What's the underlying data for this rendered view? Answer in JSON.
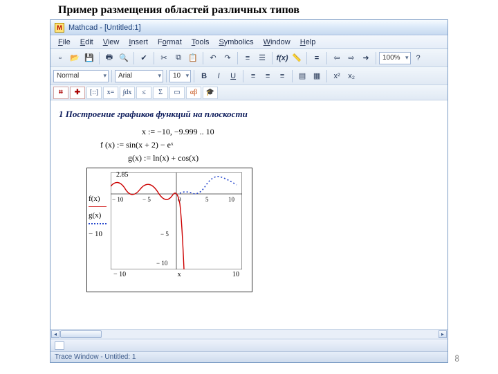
{
  "slide": {
    "title": "Пример размещения областей различных типов",
    "number": "8"
  },
  "window": {
    "app_title": "Mathcad - [Untitled:1]",
    "logo_letter": "M"
  },
  "menus": {
    "file": "File",
    "edit": "Edit",
    "view": "View",
    "insert": "Insert",
    "format": "Format",
    "tools": "Tools",
    "symbolics": "Symbolics",
    "window": "Window",
    "help": "Help"
  },
  "format_toolbar": {
    "style": "Normal",
    "font": "Arial",
    "size": "10",
    "zoom": "100%"
  },
  "mathbar": {
    "btn_graph": "⌗",
    "btn_matrix": "[::]",
    "btn_eval": "x=",
    "btn_int": "∫dx",
    "btn_le": "≤",
    "btn_sum": "Σ",
    "btn_prog": "▭",
    "btn_greek": "αβ",
    "btn_book": "🎓"
  },
  "document": {
    "heading": "1 Построение графиков функций на плоскости",
    "eq1": "x := −10, −9.999 .. 10",
    "eq2": "f (x) := sin(x + 2) − eˣ",
    "eq3": "g(x) := ln(x) + cos(x)"
  },
  "plot": {
    "y_top": "2.85",
    "y_mid": "− 5",
    "y_low": "− 10",
    "trace1": "f(x)",
    "trace2": "g(x)",
    "y_bottom_lim": "− 10",
    "x_min": "− 10",
    "x_mid": "x",
    "x_max": "10",
    "xtick_n10": "− 10",
    "xtick_n5": "− 5",
    "xtick_0": "0",
    "xtick_5": "5",
    "xtick_10": "10"
  },
  "status": {
    "trace": "Trace Window - Untitled: 1"
  },
  "chart_data": {
    "type": "line",
    "title": "",
    "xlabel": "x",
    "ylabel": "",
    "xlim": [
      -10,
      10
    ],
    "ylim": [
      -10,
      2.85
    ],
    "series": [
      {
        "name": "f(x)",
        "color": "#c00",
        "style": "solid",
        "x": [
          -10,
          -9,
          -8,
          -7,
          -6,
          -5,
          -4,
          -3,
          -2,
          -1,
          0,
          0.5,
          0.8,
          1.0
        ],
        "y": [
          0.99,
          0.66,
          0.28,
          -0.96,
          -0.76,
          0.14,
          0.91,
          0.79,
          -0.37,
          -1.21,
          -0.09,
          -1.05,
          -1.89,
          -2.58
        ]
      },
      {
        "name": "g(x)",
        "color": "#2244cc",
        "style": "dotted",
        "x": [
          0.5,
          1,
          2,
          3,
          4,
          5,
          6,
          7,
          8,
          9,
          10
        ],
        "y": [
          0.18,
          0.54,
          0.28,
          0.11,
          0.73,
          1.89,
          2.75,
          2.7,
          1.93,
          1.29,
          1.46
        ]
      }
    ]
  }
}
